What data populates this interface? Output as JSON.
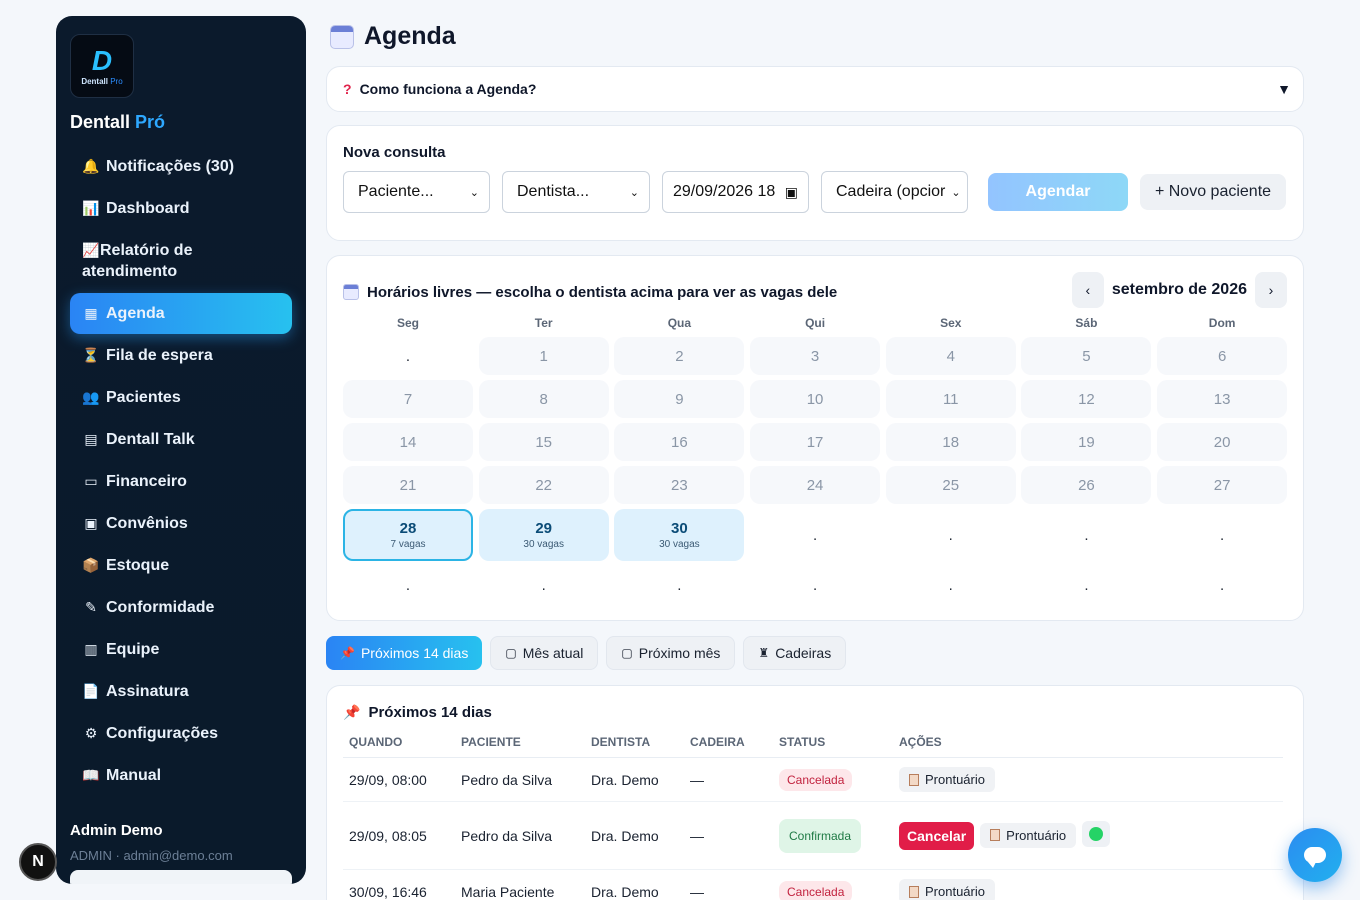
{
  "sidebar": {
    "logo_mark": "D",
    "logo_text": "Dentall",
    "logo_text_accent": "Pro",
    "brand": "Dentall",
    "brand_accent": "Pró",
    "items": [
      {
        "label": "Notificações (30)",
        "icon": "bell-icon",
        "glyph": "🔔"
      },
      {
        "label": "Dashboard",
        "icon": "chart-bar-icon",
        "glyph": "📊"
      },
      {
        "label": "Relatório de atendimento",
        "icon": "chart-line-icon",
        "glyph": "📈"
      },
      {
        "label": "Agenda",
        "icon": "calendar-icon",
        "glyph": "▦",
        "active": true
      },
      {
        "label": "Fila de espera",
        "icon": "hourglass-icon",
        "glyph": "⏳"
      },
      {
        "label": "Pacientes",
        "icon": "users-icon",
        "glyph": "👥"
      },
      {
        "label": "Dentall Talk",
        "icon": "talk-icon",
        "glyph": "▤"
      },
      {
        "label": "Financeiro",
        "icon": "card-icon",
        "glyph": "▭"
      },
      {
        "label": "Convênios",
        "icon": "clipboard-icon",
        "glyph": "▣"
      },
      {
        "label": "Estoque",
        "icon": "box-icon",
        "glyph": "📦"
      },
      {
        "label": "Conformidade",
        "icon": "pen-icon",
        "glyph": "✎"
      },
      {
        "label": "Equipe",
        "icon": "id-card-icon",
        "glyph": "▥"
      },
      {
        "label": "Assinatura",
        "icon": "document-icon",
        "glyph": "📄"
      },
      {
        "label": "Configurações",
        "icon": "gear-icon",
        "glyph": "⚙"
      },
      {
        "label": "Manual",
        "icon": "book-icon",
        "glyph": "📖"
      }
    ],
    "user_name": "Admin Demo",
    "user_meta": "ADMIN · admin@demo.com",
    "n_badge": "N"
  },
  "header": {
    "title": "Agenda"
  },
  "help": {
    "label": "Como funciona a Agenda?",
    "q": "?",
    "arrow": "▼"
  },
  "nova": {
    "title": "Nova consulta",
    "paciente": "Paciente...",
    "dentista": "Dentista...",
    "datetime": "29/09/2026 18",
    "cadeira": "Cadeira (opcior",
    "agendar": "Agendar",
    "novo_paciente": "+ Novo paciente"
  },
  "calendar": {
    "title": "Horários livres — escolha o dentista acima para ver as vagas dele",
    "month": "setembro de 2026",
    "prev": "‹",
    "next": "›",
    "weekdays": [
      "Seg",
      "Ter",
      "Qua",
      "Qui",
      "Sex",
      "Sáb",
      "Dom"
    ],
    "rows": [
      [
        ".",
        "1",
        "2",
        "3",
        "4",
        "5",
        "6"
      ],
      [
        "7",
        "8",
        "9",
        "10",
        "11",
        "12",
        "13"
      ],
      [
        "14",
        "15",
        "16",
        "17",
        "18",
        "19",
        "20"
      ],
      [
        "21",
        "22",
        "23",
        "24",
        "25",
        "26",
        "27"
      ],
      [
        "28",
        "29",
        "30",
        ".",
        ".",
        ".",
        "."
      ],
      [
        ".",
        ".",
        ".",
        ".",
        ".",
        ".",
        "."
      ]
    ],
    "available": {
      "28": "7 vagas",
      "29": "30 vagas",
      "30": "30 vagas"
    },
    "selected": "28"
  },
  "tabs": [
    {
      "label": "Próximos 14 dias",
      "glyph": "📌",
      "active": true
    },
    {
      "label": "Mês atual",
      "glyph": "▢"
    },
    {
      "label": "Próximo mês",
      "glyph": "▢"
    },
    {
      "label": "Cadeiras",
      "glyph": "♜"
    }
  ],
  "list": {
    "title": "Próximos 14 dias",
    "pin": "📌",
    "columns": [
      "QUANDO",
      "PACIENTE",
      "DENTISTA",
      "CADEIRA",
      "STATUS",
      "AÇÕES"
    ],
    "rows": [
      {
        "quando": "29/09, 08:00",
        "paciente": "Pedro da Silva",
        "dentista": "Dra. Demo",
        "cadeira": "—",
        "status": "Cancelada",
        "acoes": [
          "Prontuário"
        ]
      },
      {
        "quando": "29/09, 08:05",
        "paciente": "Pedro da Silva",
        "dentista": "Dra. Demo",
        "cadeira": "—",
        "status": "Confirmada",
        "acoes": [
          "Cancelar",
          "Prontuário",
          "whatsapp"
        ]
      },
      {
        "quando": "30/09, 16:46",
        "paciente": "Maria Paciente",
        "dentista": "Dra. Demo",
        "cadeira": "—",
        "status": "Cancelada",
        "acoes": [
          "Prontuário"
        ]
      }
    ]
  },
  "colors": {
    "accent_start": "#2a84f4",
    "accent_end": "#27c1ef",
    "sidebar_bg": "#0b1a2c",
    "danger": "#e11d48",
    "success_bg": "#dff5e7"
  }
}
